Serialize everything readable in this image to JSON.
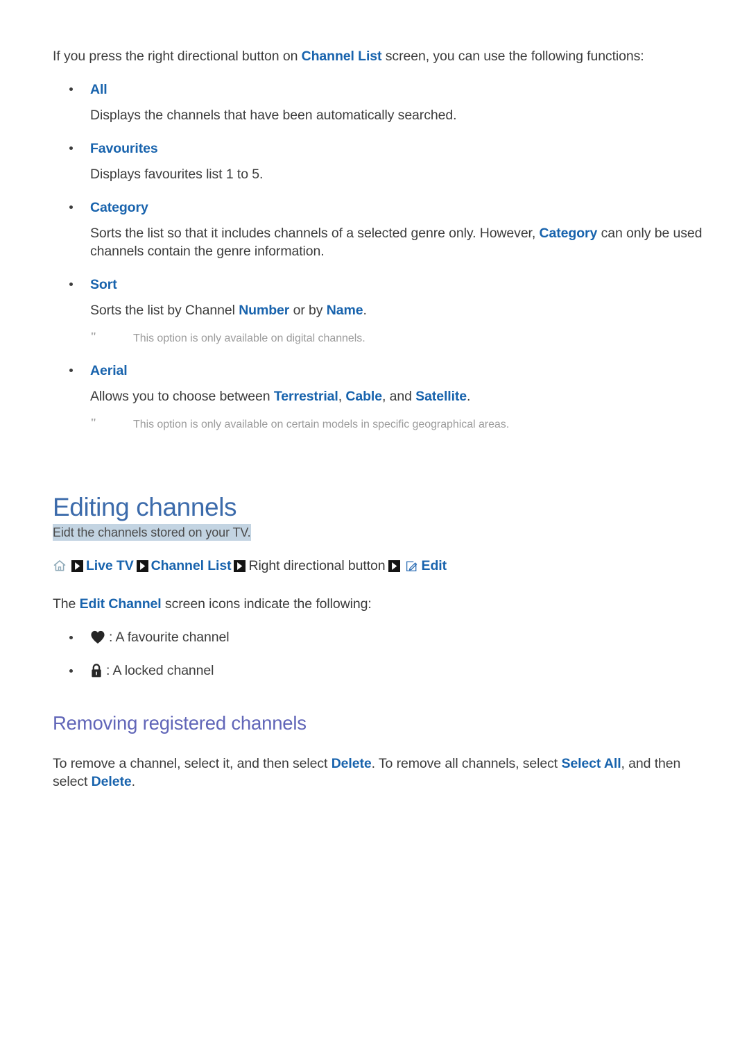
{
  "intro": {
    "before": "If you press the right directional button on ",
    "keyword": "Channel List",
    "after": " screen, you can use the following functions:"
  },
  "options": [
    {
      "title": "All",
      "desc_parts": [
        {
          "text": "Displays the channels that have been automatically searched.",
          "kw": false
        }
      ],
      "note": null
    },
    {
      "title": "Favourites",
      "desc_parts": [
        {
          "text": "Displays favourites list 1 to 5.",
          "kw": false
        }
      ],
      "note": null
    },
    {
      "title": "Category",
      "desc_parts": [
        {
          "text": "Sorts the list so that it includes channels of a selected genre only. However, ",
          "kw": false
        },
        {
          "text": "Category",
          "kw": true
        },
        {
          "text": " can only be used channels contain the genre information.",
          "kw": false
        }
      ],
      "note": null
    },
    {
      "title": "Sort",
      "desc_parts": [
        {
          "text": "Sorts the list by Channel ",
          "kw": false
        },
        {
          "text": "Number",
          "kw": true
        },
        {
          "text": " or by ",
          "kw": false
        },
        {
          "text": "Name",
          "kw": true
        },
        {
          "text": ".",
          "kw": false
        }
      ],
      "note": {
        "mark": "\"",
        "text": "This option is only available on digital channels."
      }
    },
    {
      "title": "Aerial",
      "desc_parts": [
        {
          "text": "Allows you to choose between ",
          "kw": false
        },
        {
          "text": "Terrestrial",
          "kw": true
        },
        {
          "text": ", ",
          "kw": false
        },
        {
          "text": "Cable",
          "kw": true
        },
        {
          "text": ", and ",
          "kw": false
        },
        {
          "text": "Satellite",
          "kw": true
        },
        {
          "text": ".",
          "kw": false
        }
      ],
      "note": {
        "mark": "\"",
        "text": "This option is only available on certain models in specific geographical areas."
      }
    }
  ],
  "editing_section": {
    "heading": "Editing channels",
    "subheading_highlighted": "Eidt the channels stored on your TV.",
    "breadcrumb": {
      "home_icon": "home-icon",
      "chevron_icon": "chevron-right-icon",
      "edit_icon": "edit-pencil-icon",
      "items": [
        {
          "label": "Live TV",
          "type": "link"
        },
        {
          "label": "Channel List",
          "type": "link"
        },
        {
          "label": "Right directional button",
          "type": "plain"
        },
        {
          "label": "Edit",
          "type": "link"
        }
      ]
    },
    "icons_intro": {
      "before": "The ",
      "keyword": "Edit Channel",
      "after": " screen icons indicate the following:"
    },
    "legend": [
      {
        "icon": "heart-icon",
        "label": ": A favourite channel"
      },
      {
        "icon": "lock-icon",
        "label": ": A locked channel"
      }
    ]
  },
  "removing_section": {
    "heading": "Removing registered channels",
    "body_parts": [
      {
        "text": "To remove a channel, select it, and then select ",
        "kw": false
      },
      {
        "text": "Delete",
        "kw": true
      },
      {
        "text": ". To remove all channels, select ",
        "kw": false
      },
      {
        "text": "Select All",
        "kw": true
      },
      {
        "text": ", and then select ",
        "kw": false
      },
      {
        "text": "Delete",
        "kw": true
      },
      {
        "text": ".",
        "kw": false
      }
    ]
  },
  "colors": {
    "link_blue": "#1863ad",
    "h1_blue": "#3c6bab",
    "h2_purple": "#6166b8",
    "highlight_bg": "#c3d4e2",
    "body_text": "#3c3c3c",
    "note_gray": "#9b9b9b",
    "home_icon": "#8ea9b8",
    "icon_black": "#262626"
  }
}
